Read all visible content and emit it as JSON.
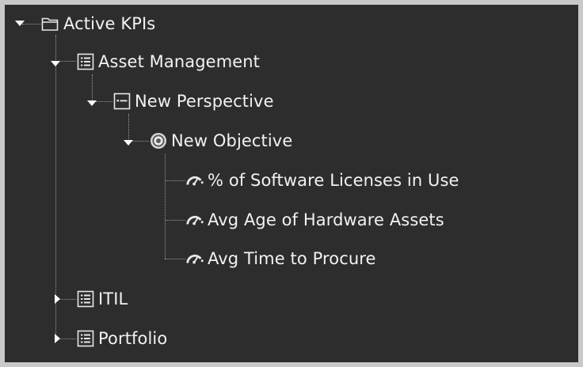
{
  "tree": {
    "root": {
      "label": "Active KPIs",
      "icon": "folder-open-icon",
      "state": "expanded"
    },
    "asset_management": {
      "label": "Asset Management",
      "icon": "scorecard-list-icon",
      "state": "expanded"
    },
    "perspective": {
      "label": "New Perspective",
      "icon": "perspective-icon",
      "state": "expanded"
    },
    "objective": {
      "label": "New Objective",
      "icon": "objective-target-icon",
      "state": "expanded"
    },
    "kpis": [
      {
        "label": "% of Software Licenses in Use",
        "icon": "gauge-icon"
      },
      {
        "label": "Avg Age of Hardware Assets",
        "icon": "gauge-icon"
      },
      {
        "label": "Avg Time to Procure",
        "icon": "gauge-icon"
      }
    ],
    "itil": {
      "label": "ITIL",
      "icon": "scorecard-list-icon",
      "state": "collapsed"
    },
    "portfolio": {
      "label": "Portfolio",
      "icon": "scorecard-list-icon",
      "state": "collapsed"
    }
  },
  "colors": {
    "panel_background": "#2d2d2d",
    "frame_background": "#c9c9c9",
    "text": "#f2f2f2",
    "connector": "#9a9a9a"
  }
}
